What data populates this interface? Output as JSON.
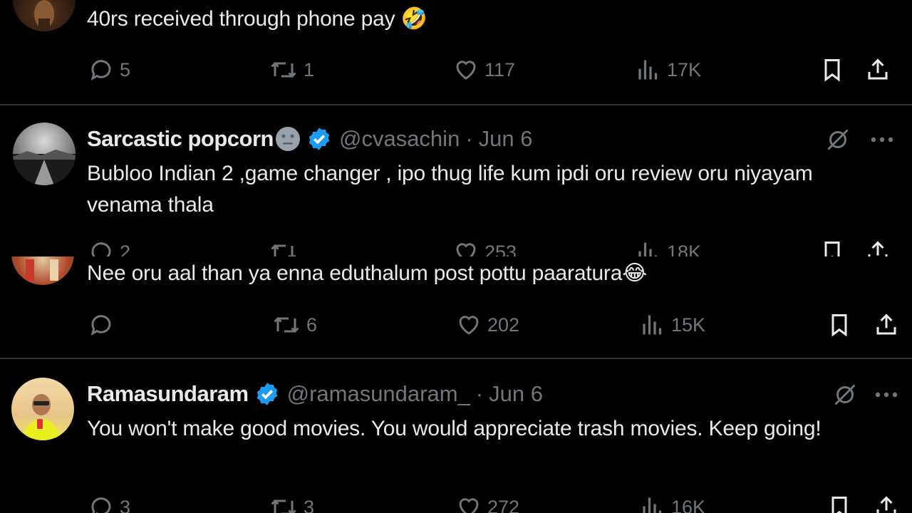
{
  "tweets": [
    {
      "text": "40rs received through phone pay",
      "emoji": "🤣",
      "stats": {
        "replies": "5",
        "reposts": "1",
        "likes": "117",
        "views": "17K"
      }
    },
    {
      "name": "Sarcastic popcorn",
      "handle": "@cvasachin",
      "separator": "·",
      "date": "Jun 6",
      "text": "Bubloo Indian 2 ,game changer , ipo thug life kum ipdi oru review oru niyayam venama thala",
      "stats": {
        "replies": "2",
        "reposts": "",
        "likes": "253",
        "views": "18K"
      }
    },
    {
      "text": "Nee oru aal than ya enna eduthalum post pottu paaratura",
      "emoji": "😂",
      "stats": {
        "replies": "",
        "reposts": "6",
        "likes": "202",
        "views": "15K"
      }
    },
    {
      "name": "Ramasundaram",
      "handle": "@ramasundaram_",
      "separator": "·",
      "date": "Jun 6",
      "text": "You won't make good movies. You would appreciate trash movies. Keep going!",
      "stats": {
        "replies": "3",
        "reposts": "3",
        "likes": "272",
        "views": "16K"
      }
    }
  ],
  "colors": {
    "background": "#000000",
    "text": "#e7e9ea",
    "muted": "#71767b",
    "verified": "#1d9bf0",
    "divider": "#2f3336"
  }
}
